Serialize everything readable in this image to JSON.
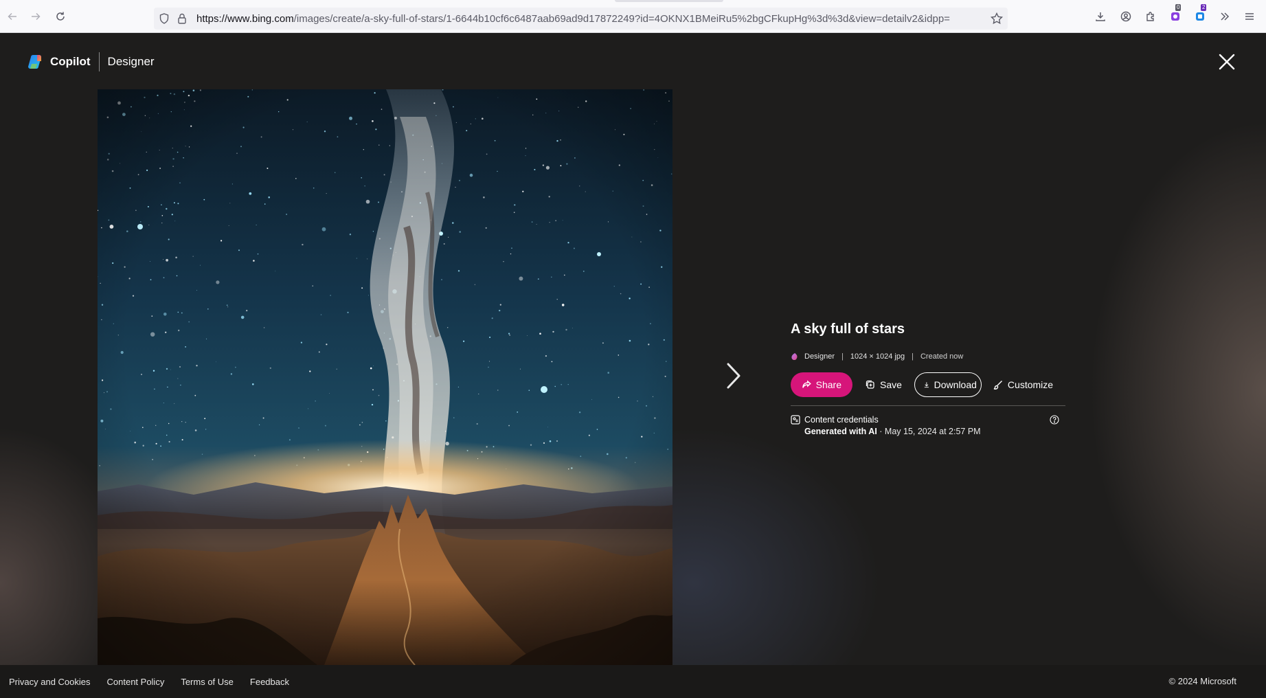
{
  "browser": {
    "url_host": "https://www.bing.com",
    "url_rest": "/images/create/a-sky-full-of-stars/1-6644b10cf6c6487aab69ad9d17872249?id=4OKNX1BMeiRu5%2bgCFkupHg%3d%3d&view=detailv2&idpp=",
    "extension_badges": [
      "0",
      "2"
    ],
    "icons": [
      "back-icon",
      "forward-icon",
      "reload-icon",
      "shield-icon",
      "lock-icon",
      "bookmark-star-icon",
      "downloads-icon",
      "account-icon",
      "extensions-icon",
      "overflow-icon",
      "menu-icon"
    ]
  },
  "header": {
    "brand": "Copilot",
    "product": "Designer"
  },
  "image": {
    "title": "A sky full of stars",
    "source": "Designer",
    "dimensions": "1024 × 1024 jpg",
    "created": "Created now"
  },
  "actions": {
    "share": "Share",
    "save": "Save",
    "download": "Download",
    "customize": "Customize"
  },
  "credentials": {
    "label": "Content credentials",
    "generated": "Generated with AI",
    "date": " · May 15, 2024 at 2:57 PM"
  },
  "footer": {
    "links": [
      "Privacy and Cookies",
      "Content Policy",
      "Terms of Use",
      "Feedback"
    ],
    "copyright": "© 2024 Microsoft"
  },
  "colors": {
    "share_button": "#d6157a",
    "page_background": "#1e1d1c"
  }
}
